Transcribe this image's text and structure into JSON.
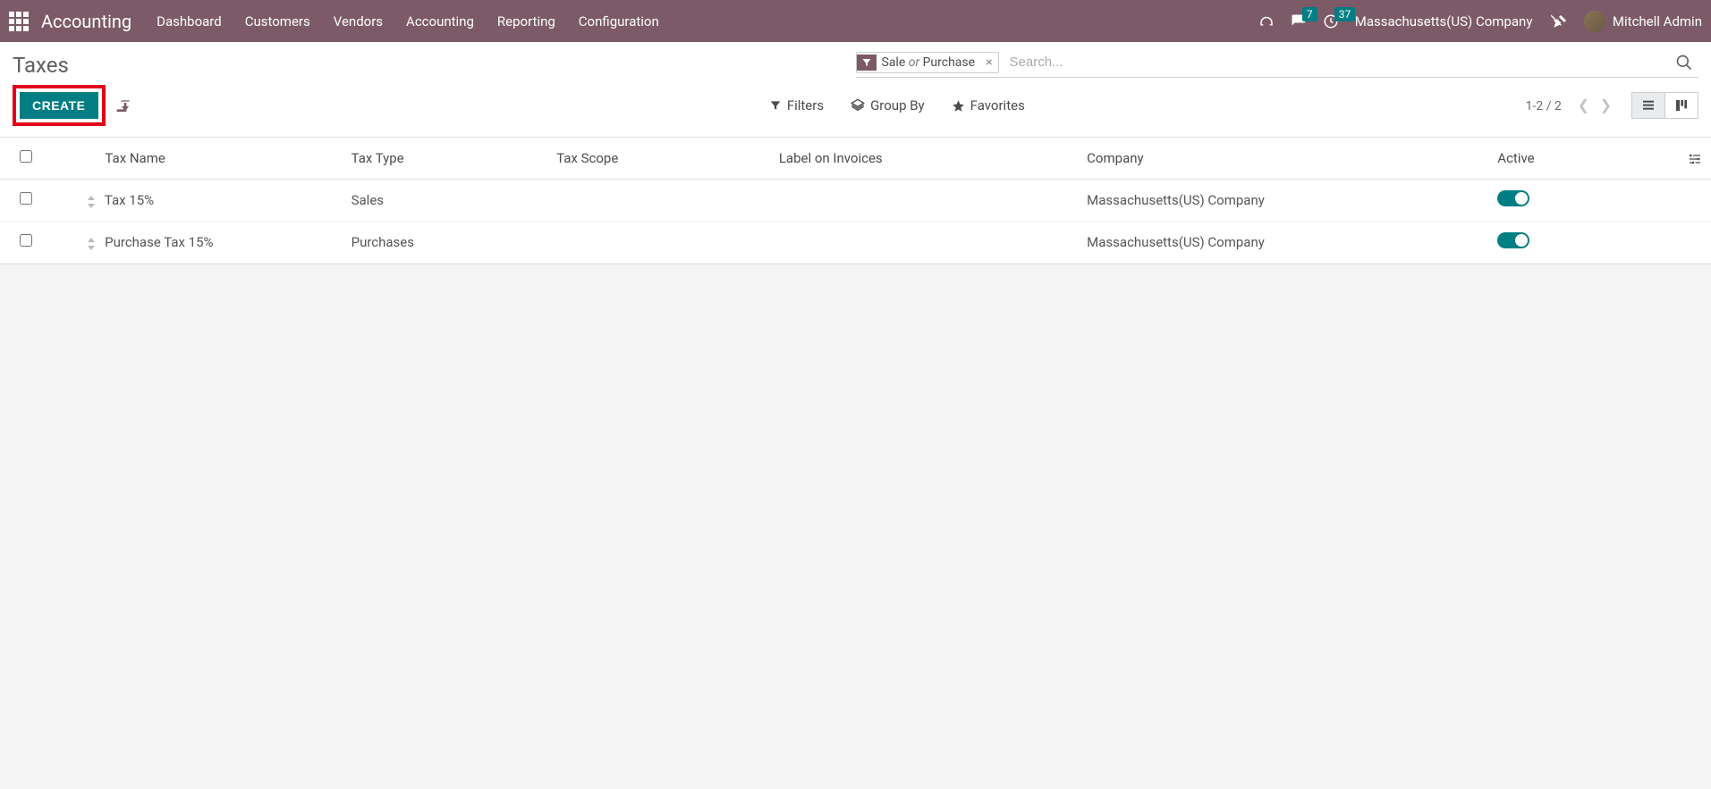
{
  "navbar": {
    "brand": "Accounting",
    "menu": [
      "Dashboard",
      "Customers",
      "Vendors",
      "Accounting",
      "Reporting",
      "Configuration"
    ],
    "messages_badge": "7",
    "activities_badge": "37",
    "company": "Massachusetts(US) Company",
    "user": "Mitchell Admin"
  },
  "breadcrumb": "Taxes",
  "search": {
    "facet_a": "Sale",
    "facet_or": "or",
    "facet_b": "Purchase",
    "placeholder": "Search..."
  },
  "buttons": {
    "create": "CREATE",
    "filters": "Filters",
    "groupby": "Group By",
    "favorites": "Favorites"
  },
  "pager": "1-2 / 2",
  "columns": {
    "name": "Tax Name",
    "type": "Tax Type",
    "scope": "Tax Scope",
    "label": "Label on Invoices",
    "company": "Company",
    "active": "Active"
  },
  "rows": [
    {
      "name": "Tax 15%",
      "type": "Sales",
      "scope": "",
      "label": "",
      "company": "Massachusetts(US) Company",
      "active": true
    },
    {
      "name": "Purchase Tax 15%",
      "type": "Purchases",
      "scope": "",
      "label": "",
      "company": "Massachusetts(US) Company",
      "active": true
    }
  ]
}
